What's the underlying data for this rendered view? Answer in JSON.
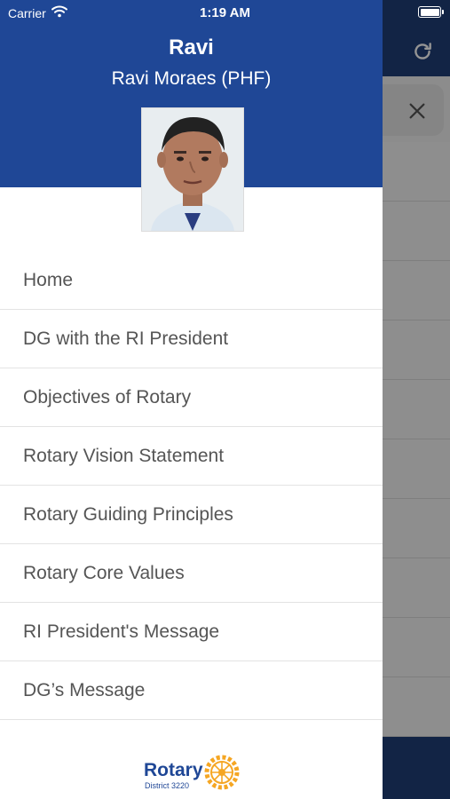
{
  "status_bar": {
    "carrier": "Carrier",
    "time": "1:19 AM"
  },
  "drawer": {
    "user_name": "Ravi",
    "user_full_name": "Ravi Moraes (PHF)",
    "menu": [
      {
        "label": "Home"
      },
      {
        "label": "DG with the RI President"
      },
      {
        "label": "Objectives of Rotary"
      },
      {
        "label": "Rotary Vision Statement"
      },
      {
        "label": "Rotary Guiding Principles"
      },
      {
        "label": "Rotary Core Values"
      },
      {
        "label": "RI President's Message"
      },
      {
        "label": "DG’s Message"
      }
    ],
    "logo": {
      "name": "Rotary",
      "district": "District 3220"
    }
  },
  "background_app": {
    "icons": [
      "refresh-icon",
      "close-icon"
    ]
  },
  "colors": {
    "header_blue": "#1f4796",
    "menu_text": "#555555",
    "rotary_gold": "#f5a623"
  }
}
